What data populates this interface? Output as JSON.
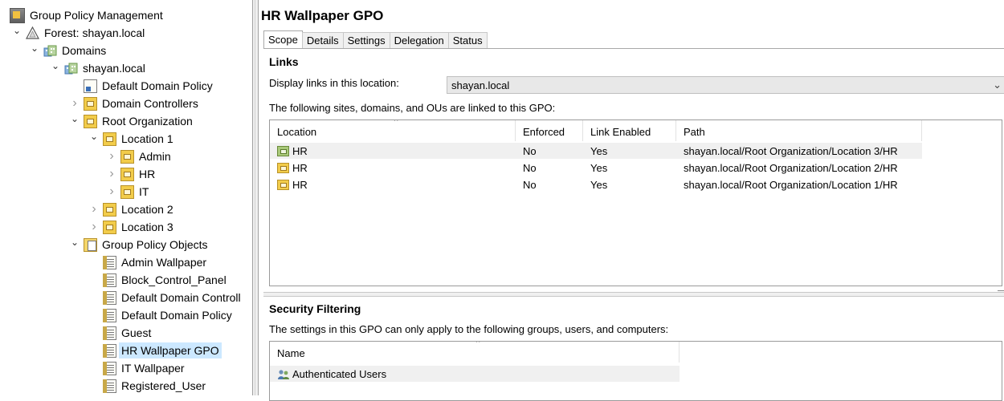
{
  "tree": {
    "items": [
      {
        "label": "Group Policy Management",
        "icon": "group-policy-management-icon",
        "toggle": ""
      },
      {
        "label": "Forest: shayan.local",
        "icon": "forest-icon",
        "toggle": "expanded"
      },
      {
        "label": "Domains",
        "icon": "domains-icon",
        "toggle": "expanded"
      },
      {
        "label": "shayan.local",
        "icon": "domain-icon",
        "toggle": "expanded"
      },
      {
        "label": "Default Domain Policy",
        "icon": "gpo-link-icon",
        "toggle": ""
      },
      {
        "label": "Domain Controllers",
        "icon": "ou-icon",
        "toggle": "collapsed"
      },
      {
        "label": "Root Organization",
        "icon": "ou-icon",
        "toggle": "expanded"
      },
      {
        "label": "Location 1",
        "icon": "ou-icon",
        "toggle": "expanded"
      },
      {
        "label": "Admin",
        "icon": "ou-icon",
        "toggle": "collapsed"
      },
      {
        "label": "HR",
        "icon": "ou-icon",
        "toggle": "collapsed"
      },
      {
        "label": "IT",
        "icon": "ou-icon",
        "toggle": "collapsed"
      },
      {
        "label": "Location 2",
        "icon": "ou-icon",
        "toggle": "collapsed"
      },
      {
        "label": "Location 3",
        "icon": "ou-icon",
        "toggle": "collapsed"
      },
      {
        "label": "Group Policy Objects",
        "icon": "gpo-folder-icon",
        "toggle": "expanded"
      },
      {
        "label": "Admin Wallpaper",
        "icon": "gpo-icon",
        "toggle": ""
      },
      {
        "label": "Block_Control_Panel",
        "icon": "gpo-icon",
        "toggle": ""
      },
      {
        "label": "Default Domain Controll",
        "icon": "gpo-icon",
        "toggle": ""
      },
      {
        "label": "Default Domain Policy",
        "icon": "gpo-icon",
        "toggle": ""
      },
      {
        "label": "Guest",
        "icon": "gpo-icon",
        "toggle": ""
      },
      {
        "label": "HR Wallpaper GPO",
        "icon": "gpo-icon",
        "toggle": "",
        "selected": true
      },
      {
        "label": "IT Wallpaper",
        "icon": "gpo-icon",
        "toggle": ""
      },
      {
        "label": "Registered_User",
        "icon": "gpo-icon",
        "toggle": ""
      }
    ]
  },
  "details": {
    "title": "HR Wallpaper GPO",
    "tabs": [
      "Scope",
      "Details",
      "Settings",
      "Delegation",
      "Status"
    ],
    "active_tab": "Scope",
    "links": {
      "heading": "Links",
      "display_label": "Display links in this location:",
      "location_value": "shayan.local",
      "description": "The following sites, domains, and OUs are linked to this GPO:",
      "columns": [
        "Location",
        "Enforced",
        "Link Enabled",
        "Path"
      ],
      "rows": [
        {
          "location": "HR",
          "enforced": "No",
          "link_enabled": "Yes",
          "path": "shayan.local/Root Organization/Location 3/HR",
          "icon": "ou-green-icon",
          "highlighted": true
        },
        {
          "location": "HR",
          "enforced": "No",
          "link_enabled": "Yes",
          "path": "shayan.local/Root Organization/Location 2/HR",
          "icon": "ou-icon"
        },
        {
          "location": "HR",
          "enforced": "No",
          "link_enabled": "Yes",
          "path": "shayan.local/Root Organization/Location 1/HR",
          "icon": "ou-icon"
        }
      ]
    },
    "security_filtering": {
      "heading": "Security Filtering",
      "description": "The settings in this GPO can only apply to the following groups, users, and computers:",
      "columns": [
        "Name"
      ],
      "rows": [
        {
          "name": "Authenticated Users",
          "icon": "users-group-icon",
          "highlighted": true
        }
      ]
    }
  },
  "colors": {
    "selection": "#cce8ff",
    "row_highlight": "#f0f0f0",
    "ou_folder": "#f2cc4a"
  }
}
